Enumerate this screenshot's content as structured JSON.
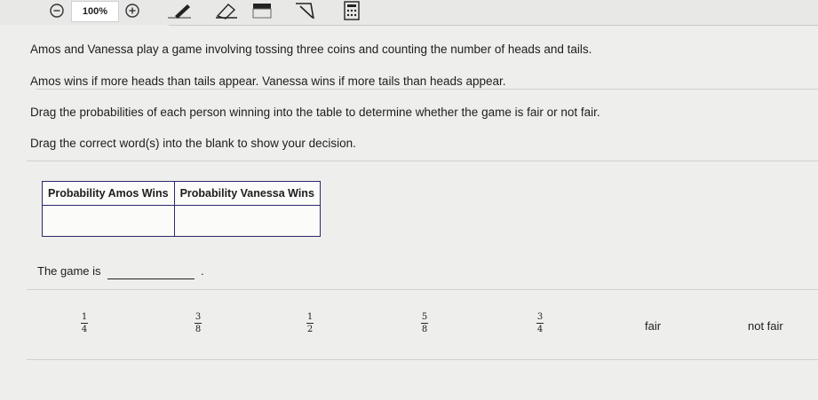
{
  "toolbar": {
    "zoom_level": "100%"
  },
  "question": {
    "line1": "Amos and Vanessa play a game involving tossing three coins and counting the number of heads and tails.",
    "line2": "Amos wins if more heads than tails appear. Vanessa wins if more tails than heads appear.",
    "line3": "Drag the probabilities of each person winning into the table to determine whether the game is fair or not fair.",
    "line4": "Drag the correct word(s) into the blank to show your decision."
  },
  "table": {
    "headers": [
      "Probability Amos Wins",
      "Probability Vanessa Wins"
    ]
  },
  "statement": {
    "prefix": "The game is",
    "suffix": "."
  },
  "choices": {
    "fractions": [
      {
        "num": "1",
        "den": "4"
      },
      {
        "num": "3",
        "den": "8"
      },
      {
        "num": "1",
        "den": "2"
      },
      {
        "num": "5",
        "den": "8"
      },
      {
        "num": "3",
        "den": "4"
      }
    ],
    "words": [
      "fair",
      "not fair"
    ]
  }
}
